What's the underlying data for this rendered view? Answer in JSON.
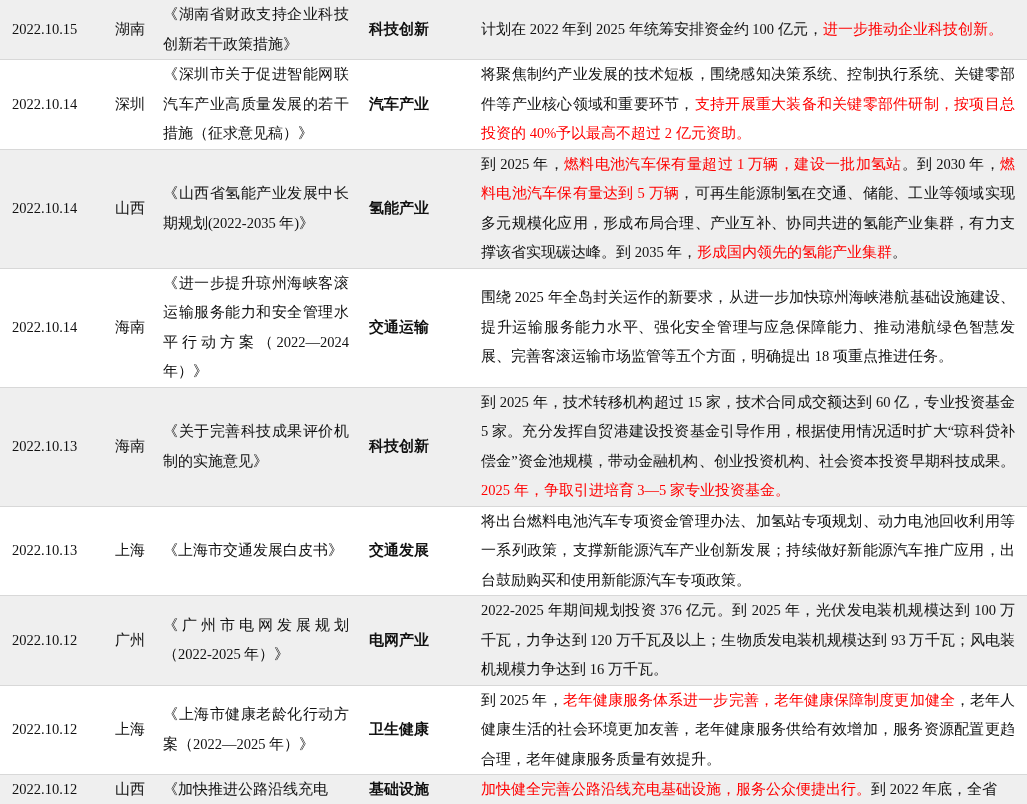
{
  "rows": [
    {
      "date": "2022.10.15",
      "region": "湖南",
      "title": "《湖南省财政支持企业科技创新若干政策措施》",
      "category": "科技创新",
      "content": [
        {
          "text": "计划在 2022 年到 2025 年统筹安排资金约 100 亿元，",
          "highlight": false
        },
        {
          "text": "进一步推动企业科技创新。",
          "highlight": true
        }
      ]
    },
    {
      "date": "2022.10.14",
      "region": "深圳",
      "title": "《深圳市关于促进智能网联汽车产业高质量发展的若干措施（征求意见稿）》",
      "category": "汽车产业",
      "content": [
        {
          "text": "将聚焦制约产业发展的技术短板，围绕感知决策系统、控制执行系统、关键零部件等产业核心领域和重要环节，",
          "highlight": false
        },
        {
          "text": "支持开展重大装备和关键零部件研制，按项目总投资的 40%予以最高不超过 2 亿元资助。",
          "highlight": true
        }
      ]
    },
    {
      "date": "2022.10.14",
      "region": "山西",
      "title": "《山西省氢能产业发展中长期规划(2022-2035 年)》",
      "category": "氢能产业",
      "content": [
        {
          "text": "到 2025 年，",
          "highlight": false
        },
        {
          "text": "燃料电池汽车保有量超过 1 万辆，建设一批加氢站",
          "highlight": true
        },
        {
          "text": "。到 2030 年，",
          "highlight": false
        },
        {
          "text": "燃料电池汽车保有量达到 5 万辆",
          "highlight": true
        },
        {
          "text": "，可再生能源制氢在交通、储能、工业等领域实现多元规模化应用，形成布局合理、产业互补、协同共进的氢能产业集群，有力支撑该省实现碳达峰。到 2035 年，",
          "highlight": false
        },
        {
          "text": "形成国内领先的氢能产业集群",
          "highlight": true
        },
        {
          "text": "。",
          "highlight": false
        }
      ]
    },
    {
      "date": "2022.10.14",
      "region": "海南",
      "title": "《进一步提升琼州海峡客滚运输服务能力和安全管理水平行动方案（2022—2024 年）》",
      "category": "交通运输",
      "content": [
        {
          "text": "围绕 2025 年全岛封关运作的新要求，从进一步加快琼州海峡港航基础设施建设、提升运输服务能力水平、强化安全管理与应急保障能力、推动港航绿色智慧发展、完善客滚运输市场监管等五个方面，明确提出 18 项重点推进任务。",
          "highlight": false
        }
      ]
    },
    {
      "date": "2022.10.13",
      "region": "海南",
      "title": "《关于完善科技成果评价机制的实施意见》",
      "category": "科技创新",
      "content": [
        {
          "text": "到 2025 年，技术转移机构超过 15 家，技术合同成交额达到 60 亿，专业投资基金 5 家。充分发挥自贸港建设投资基金引导作用，根据使用情况适时扩大“琼科贷补偿金”资金池规模，带动金融机构、创业投资机构、社会资本投资早期科技成果。",
          "highlight": false
        },
        {
          "text": "2025 年，争取引进培育 3—5 家专业投资基金。",
          "highlight": true
        }
      ]
    },
    {
      "date": "2022.10.13",
      "region": "上海",
      "title": "《上海市交通发展白皮书》",
      "category": "交通发展",
      "content": [
        {
          "text": "将出台燃料电池汽车专项资金管理办法、加氢站专项规划、动力电池回收利用等一系列政策，支撑新能源汽车产业创新发展；持续做好新能源汽车推广应用，出台鼓励购买和使用新能源汽车专项政策。",
          "highlight": false
        }
      ]
    },
    {
      "date": "2022.10.12",
      "region": "广州",
      "title": "《广州市电网发展规划（2022-2025 年）》",
      "category": "电网产业",
      "content": [
        {
          "text": "2022-2025 年期间规划投资 376 亿元。到 2025 年，光伏发电装机规模达到 100 万千瓦，力争达到 120 万千瓦及以上；生物质发电装机规模达到 93 万千瓦；风电装机规模力争达到 16 万千瓦。",
          "highlight": false
        }
      ]
    },
    {
      "date": "2022.10.12",
      "region": "上海",
      "title": "《上海市健康老龄化行动方案（2022—2025 年）》",
      "category": "卫生健康",
      "content": [
        {
          "text": "到 2025 年，",
          "highlight": false
        },
        {
          "text": "老年健康服务体系进一步完善，老年健康保障制度更加健全",
          "highlight": true
        },
        {
          "text": "，老年人健康生活的社会环境更加友善，老年健康服务供给有效增加，服务资源配置更趋合理，老年健康服务质量有效提升。",
          "highlight": false
        }
      ]
    },
    {
      "date": "2022.10.12",
      "region": "山西",
      "title": "《加快推进公路沿线充电",
      "category": "基础设施",
      "content": [
        {
          "text": "加快健全完善公路沿线充电基础设施，服务公众便捷出行。",
          "highlight": true
        },
        {
          "text": "到 2022 年底，全省",
          "highlight": false
        }
      ]
    }
  ]
}
